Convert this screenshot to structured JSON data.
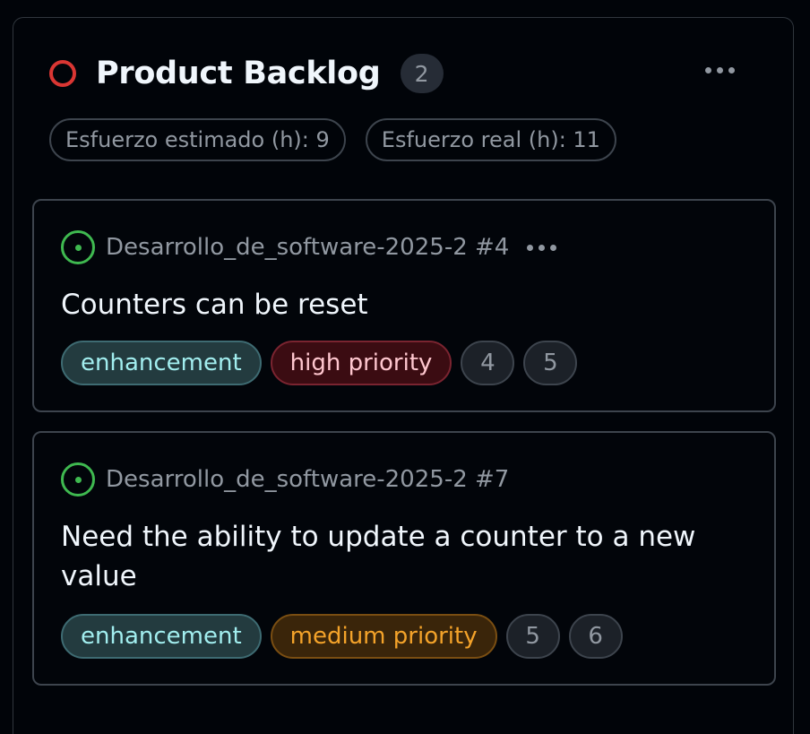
{
  "column": {
    "title": "Product Backlog",
    "count": "2",
    "status_color": "#da3633",
    "fields": [
      "Esfuerzo estimado (h): 9",
      "Esfuerzo real (h): 11"
    ]
  },
  "cards": [
    {
      "repo_ref": "Desarrollo_de_software-2025-2 #4",
      "title": "Counters can be reset",
      "labels": [
        "enhancement",
        "high priority"
      ],
      "numbers": [
        "4",
        "5"
      ],
      "status": "open"
    },
    {
      "repo_ref": "Desarrollo_de_software-2025-2 #7",
      "title": "Need the ability to update a counter to a new value",
      "labels": [
        "enhancement",
        "medium priority"
      ],
      "numbers": [
        "5",
        "6"
      ],
      "status": "open"
    }
  ],
  "icons": {
    "column_status": "closed-circle-icon",
    "issue_status": "issue-open-icon",
    "menu": "kebab-horizontal-icon"
  },
  "colors": {
    "open": "#3fb950",
    "enhancement": "#a2eeef",
    "high_priority": "#ffc7cf",
    "medium_priority": "#f4a32a"
  }
}
